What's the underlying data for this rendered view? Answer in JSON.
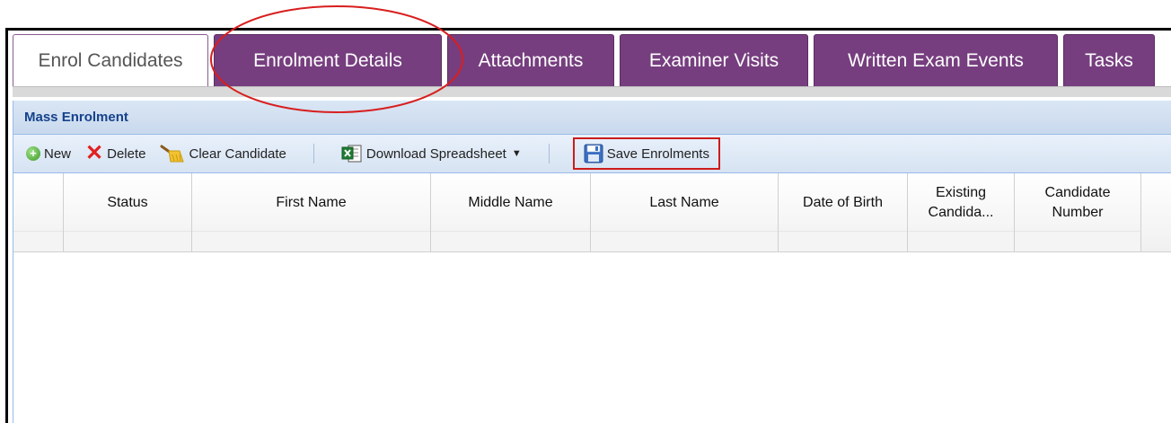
{
  "tabs": [
    {
      "label": "Enrol Candidates",
      "active": true
    },
    {
      "label": "Enrolment Details",
      "active": false
    },
    {
      "label": "Attachments",
      "active": false
    },
    {
      "label": "Examiner Visits",
      "active": false
    },
    {
      "label": "Written Exam Events",
      "active": false
    },
    {
      "label": "Tasks",
      "active": false
    }
  ],
  "panel": {
    "title": "Mass Enrolment"
  },
  "toolbar": {
    "new_label": "New",
    "delete_label": "Delete",
    "clear_label": "Clear Candidate",
    "download_label": "Download Spreadsheet",
    "save_label": "Save Enrolments"
  },
  "grid": {
    "columns": [
      {
        "label": ""
      },
      {
        "label": "Status"
      },
      {
        "label": "First Name"
      },
      {
        "label": "Middle Name"
      },
      {
        "label": "Last Name"
      },
      {
        "label": "Date of Birth"
      },
      {
        "label": "Existing Candida..."
      },
      {
        "label": "Candidate Number"
      }
    ]
  },
  "colors": {
    "tab_bg": "#763e7f",
    "annotation_circle": "#d81e1e",
    "save_highlight": "#cc1b1b"
  }
}
